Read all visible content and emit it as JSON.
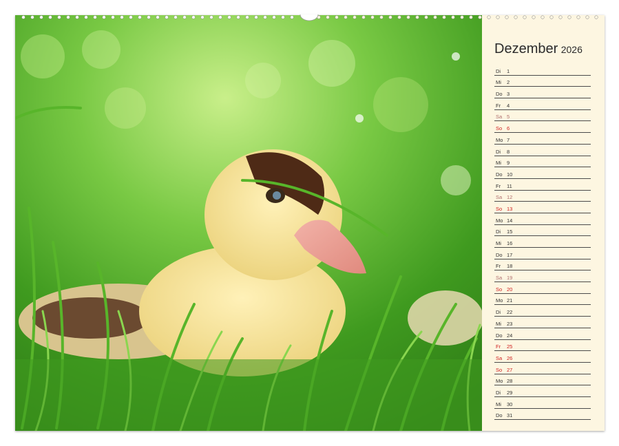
{
  "calendar": {
    "month": "Dezember",
    "year": "2026",
    "colors": {
      "weekday": "#333333",
      "saturday": "#b07070",
      "sunday_holiday": "#d02020",
      "panel": "#fdf6e1"
    },
    "days": [
      {
        "wd": "Di",
        "d": "1",
        "t": "w"
      },
      {
        "wd": "Mi",
        "d": "2",
        "t": "w"
      },
      {
        "wd": "Do",
        "d": "3",
        "t": "w"
      },
      {
        "wd": "Fr",
        "d": "4",
        "t": "w"
      },
      {
        "wd": "Sa",
        "d": "5",
        "t": "sat"
      },
      {
        "wd": "So",
        "d": "6",
        "t": "sun"
      },
      {
        "wd": "Mo",
        "d": "7",
        "t": "w"
      },
      {
        "wd": "Di",
        "d": "8",
        "t": "w"
      },
      {
        "wd": "Mi",
        "d": "9",
        "t": "w"
      },
      {
        "wd": "Do",
        "d": "10",
        "t": "w"
      },
      {
        "wd": "Fr",
        "d": "11",
        "t": "w"
      },
      {
        "wd": "Sa",
        "d": "12",
        "t": "sat"
      },
      {
        "wd": "So",
        "d": "13",
        "t": "sun"
      },
      {
        "wd": "Mo",
        "d": "14",
        "t": "w"
      },
      {
        "wd": "Di",
        "d": "15",
        "t": "w"
      },
      {
        "wd": "Mi",
        "d": "16",
        "t": "w"
      },
      {
        "wd": "Do",
        "d": "17",
        "t": "w"
      },
      {
        "wd": "Fr",
        "d": "18",
        "t": "w"
      },
      {
        "wd": "Sa",
        "d": "19",
        "t": "sat"
      },
      {
        "wd": "So",
        "d": "20",
        "t": "sun"
      },
      {
        "wd": "Mo",
        "d": "21",
        "t": "w"
      },
      {
        "wd": "Di",
        "d": "22",
        "t": "w"
      },
      {
        "wd": "Mi",
        "d": "23",
        "t": "w"
      },
      {
        "wd": "Do",
        "d": "24",
        "t": "w"
      },
      {
        "wd": "Fr",
        "d": "25",
        "t": "hol"
      },
      {
        "wd": "Sa",
        "d": "26",
        "t": "hol"
      },
      {
        "wd": "So",
        "d": "27",
        "t": "sun"
      },
      {
        "wd": "Mo",
        "d": "28",
        "t": "w"
      },
      {
        "wd": "Di",
        "d": "29",
        "t": "w"
      },
      {
        "wd": "Mi",
        "d": "30",
        "t": "w"
      },
      {
        "wd": "Do",
        "d": "31",
        "t": "w"
      }
    ]
  }
}
